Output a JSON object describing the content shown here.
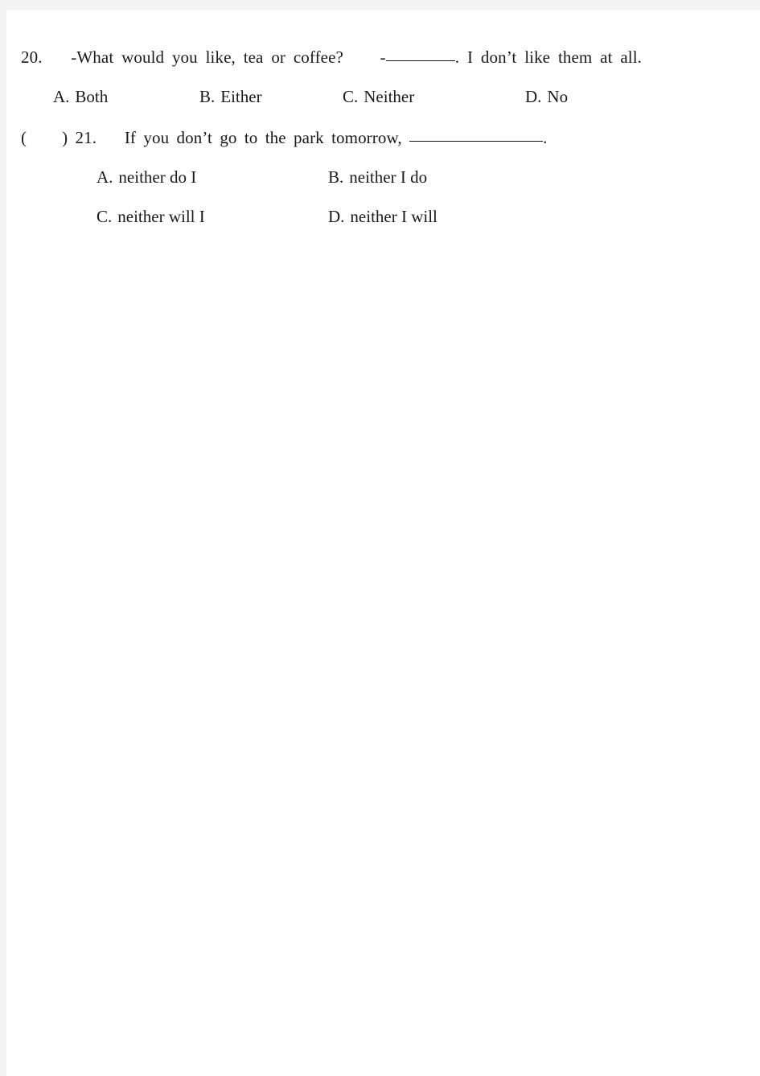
{
  "page": {
    "background_color": "#ffffff",
    "scan_margin_color": "#f4f4f5",
    "text_color": "#1a1a1a"
  },
  "questions": [
    {
      "number": "20.",
      "stem_before_blank": "-What would you like, tea or coffee?",
      "dash": "-",
      "blank": "",
      "stem_after_blank": ". I don’t like them at all.",
      "options": [
        {
          "letter": "A.",
          "text": "Both"
        },
        {
          "letter": "B.",
          "text": "Either"
        },
        {
          "letter": "C.",
          "text": "Neither"
        },
        {
          "letter": "D.",
          "text": "No"
        }
      ]
    },
    {
      "answer_bracket_open": "(",
      "answer_bracket_close": ")",
      "number": "21.",
      "stem_before_blank": "If you don’t go to the park tomorrow,",
      "blank": "",
      "stem_after_blank": ".",
      "options": [
        {
          "letter": "A.",
          "text": "neither do I"
        },
        {
          "letter": "B.",
          "text": "neither I do"
        },
        {
          "letter": "C.",
          "text": "neither will I"
        },
        {
          "letter": "D.",
          "text": "neither I will"
        }
      ]
    }
  ]
}
